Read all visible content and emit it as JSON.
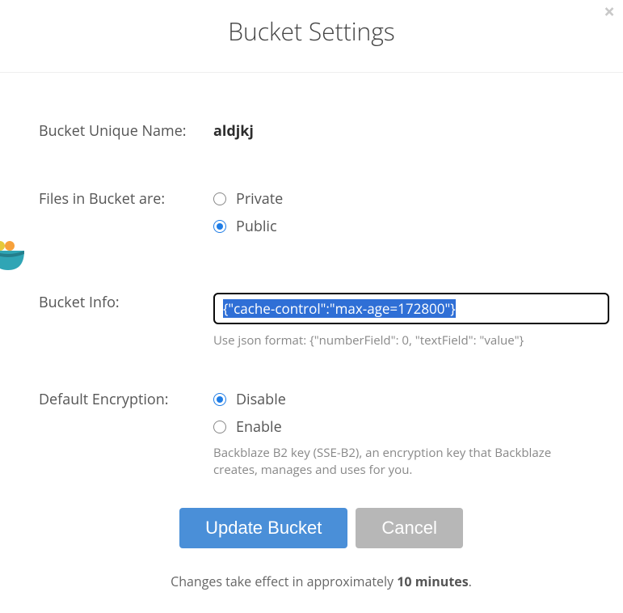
{
  "header": {
    "title": "Bucket Settings",
    "close": "×"
  },
  "fields": {
    "unique_name": {
      "label": "Bucket Unique Name:",
      "value": "aldjkj"
    },
    "files_in_bucket": {
      "label": "Files in Bucket are:",
      "options": {
        "private": "Private",
        "public": "Public"
      },
      "selected": "public"
    },
    "bucket_info": {
      "label": "Bucket Info:",
      "value": "{\"cache-control\":\"max-age=172800\"}",
      "help": "Use json format: {\"numberField\": 0, \"textField\": \"value\"}"
    },
    "encryption": {
      "label": "Default Encryption:",
      "options": {
        "disable": "Disable",
        "enable": "Enable"
      },
      "selected": "disable",
      "help": "Backblaze B2 key (SSE-B2), an encryption key that Backblaze creates, manages and uses for you."
    }
  },
  "footer": {
    "update_button": "Update Bucket",
    "cancel_button": "Cancel",
    "note_prefix": "Changes take effect in approximately ",
    "note_bold": "10 minutes",
    "note_suffix": "."
  }
}
